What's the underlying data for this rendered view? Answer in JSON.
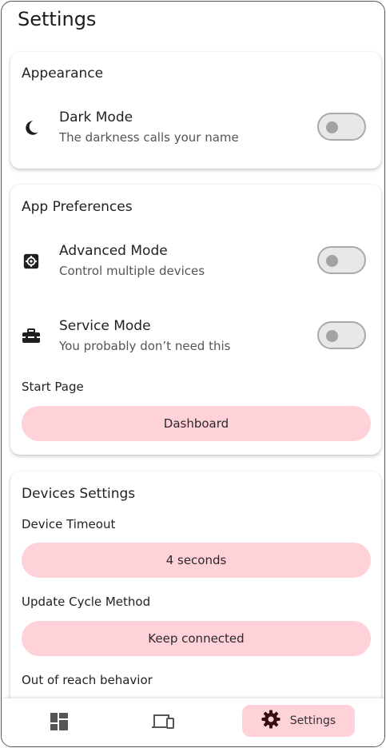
{
  "header": {
    "title": "Settings"
  },
  "appearance": {
    "title": "Appearance",
    "dark_mode": {
      "title": "Dark Mode",
      "subtitle": "The darkness calls your name",
      "icon": "moon-icon",
      "enabled": false
    }
  },
  "app_preferences": {
    "title": "App Preferences",
    "advanced_mode": {
      "title": "Advanced Mode",
      "subtitle": "Control multiple devices",
      "icon": "gear-box-icon",
      "enabled": false
    },
    "service_mode": {
      "title": "Service Mode",
      "subtitle": "You probably don’t need this",
      "icon": "toolbox-icon",
      "enabled": false
    },
    "start_page": {
      "label": "Start Page",
      "value": "Dashboard"
    }
  },
  "devices_settings": {
    "title": "Devices Settings",
    "device_timeout": {
      "label": "Device Timeout",
      "value": "4 seconds"
    },
    "update_cycle": {
      "label": "Update Cycle Method",
      "value": "Keep connected"
    },
    "out_of_reach": {
      "label": "Out of reach behavior"
    }
  },
  "navbar": {
    "items": [
      {
        "icon": "dashboard-icon"
      },
      {
        "icon": "devices-icon"
      },
      {
        "icon": "settings-gear-icon",
        "label": "Settings",
        "active": true
      }
    ]
  },
  "colors": {
    "accent": "#ffd1d8",
    "toggle_track": "#e8e8e8",
    "toggle_knob": "#a3a3a3"
  }
}
